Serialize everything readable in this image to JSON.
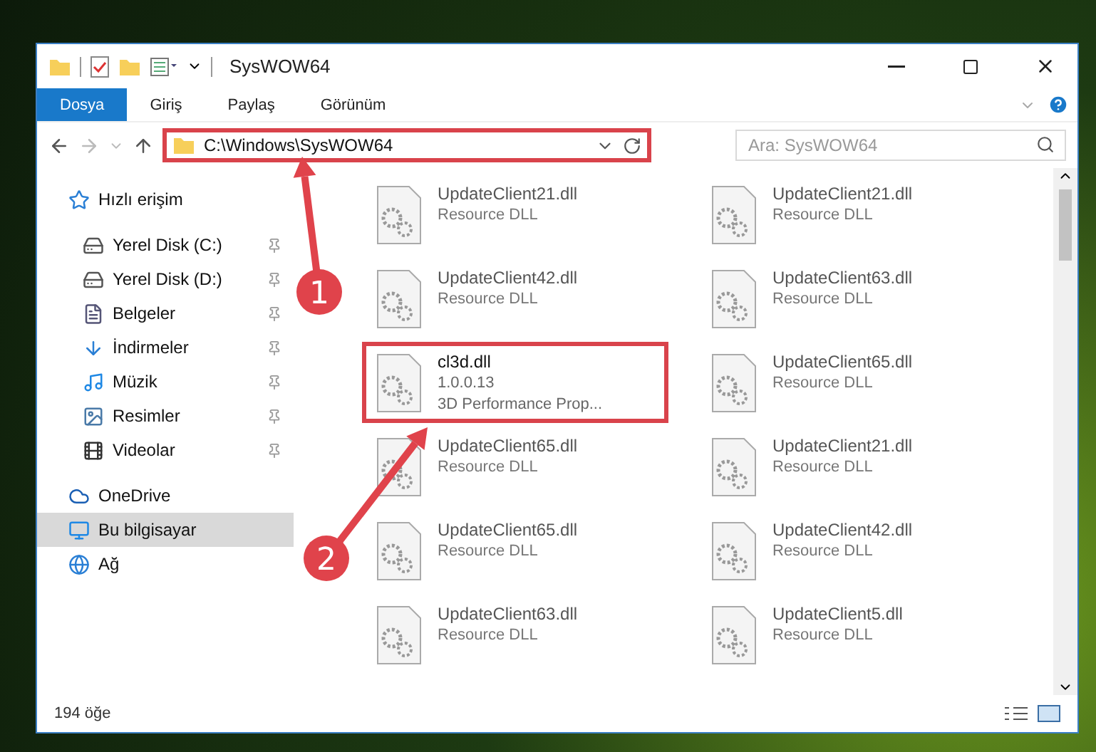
{
  "window": {
    "title": "SysWOW64"
  },
  "ribbon_tabs": [
    {
      "label": "Dosya",
      "kind": "file"
    },
    {
      "label": "Giriş",
      "kind": "tab"
    },
    {
      "label": "Paylaş",
      "kind": "tab"
    },
    {
      "label": "Görünüm",
      "kind": "tab"
    }
  ],
  "address_bar": {
    "path": "C:\\Windows\\SysWOW64",
    "highlighted": true
  },
  "search": {
    "placeholder": "Ara: SysWOW64"
  },
  "sidebar": {
    "items": [
      {
        "label": "Hızlı erişim",
        "selected": false,
        "children": [
          {
            "label": "Yerel Disk (C:)",
            "pinned": true,
            "selected": false
          },
          {
            "label": "Yerel Disk (D:)",
            "pinned": true,
            "selected": false
          },
          {
            "label": "Belgeler",
            "pinned": true,
            "selected": false
          },
          {
            "label": "İndirmeler",
            "pinned": true,
            "selected": false
          },
          {
            "label": "Müzik",
            "pinned": true,
            "selected": false
          },
          {
            "label": "Resimler",
            "pinned": true,
            "selected": false
          },
          {
            "label": "Videolar",
            "pinned": true,
            "selected": false
          }
        ]
      },
      {
        "label": "OneDrive",
        "selected": false
      },
      {
        "label": "Bu bilgisayar",
        "selected": true
      },
      {
        "label": "Ağ",
        "selected": false
      }
    ]
  },
  "files": [
    {
      "lines": [
        "UpdateClient21.dll",
        "Resource DLL"
      ],
      "highlighted": false
    },
    {
      "lines": [
        "UpdateClient21.dll",
        "Resource DLL"
      ],
      "highlighted": false
    },
    {
      "lines": [
        "UpdateClient42.dll",
        "Resource DLL"
      ],
      "highlighted": false
    },
    {
      "lines": [
        "UpdateClient63.dll",
        "Resource DLL"
      ],
      "highlighted": false
    },
    {
      "lines": [
        "cl3d.dll",
        "1.0.0.13",
        "3D Performance Prop..."
      ],
      "highlighted": true
    },
    {
      "lines": [
        "UpdateClient65.dll",
        "Resource DLL"
      ],
      "highlighted": false
    },
    {
      "lines": [
        "UpdateClient65.dll",
        "Resource DLL"
      ],
      "highlighted": false
    },
    {
      "lines": [
        "UpdateClient21.dll",
        "Resource DLL"
      ],
      "highlighted": false
    },
    {
      "lines": [
        "UpdateClient65.dll",
        "Resource DLL"
      ],
      "highlighted": false
    },
    {
      "lines": [
        "UpdateClient42.dll",
        "Resource DLL"
      ],
      "highlighted": false
    },
    {
      "lines": [
        "UpdateClient63.dll",
        "Resource DLL"
      ],
      "highlighted": false
    },
    {
      "lines": [
        "UpdateClient5.dll",
        "Resource DLL"
      ],
      "highlighted": false
    }
  ],
  "status_bar": {
    "count": "194 öğe"
  },
  "annotations": [
    {
      "label": "1"
    },
    {
      "label": "2"
    }
  ]
}
